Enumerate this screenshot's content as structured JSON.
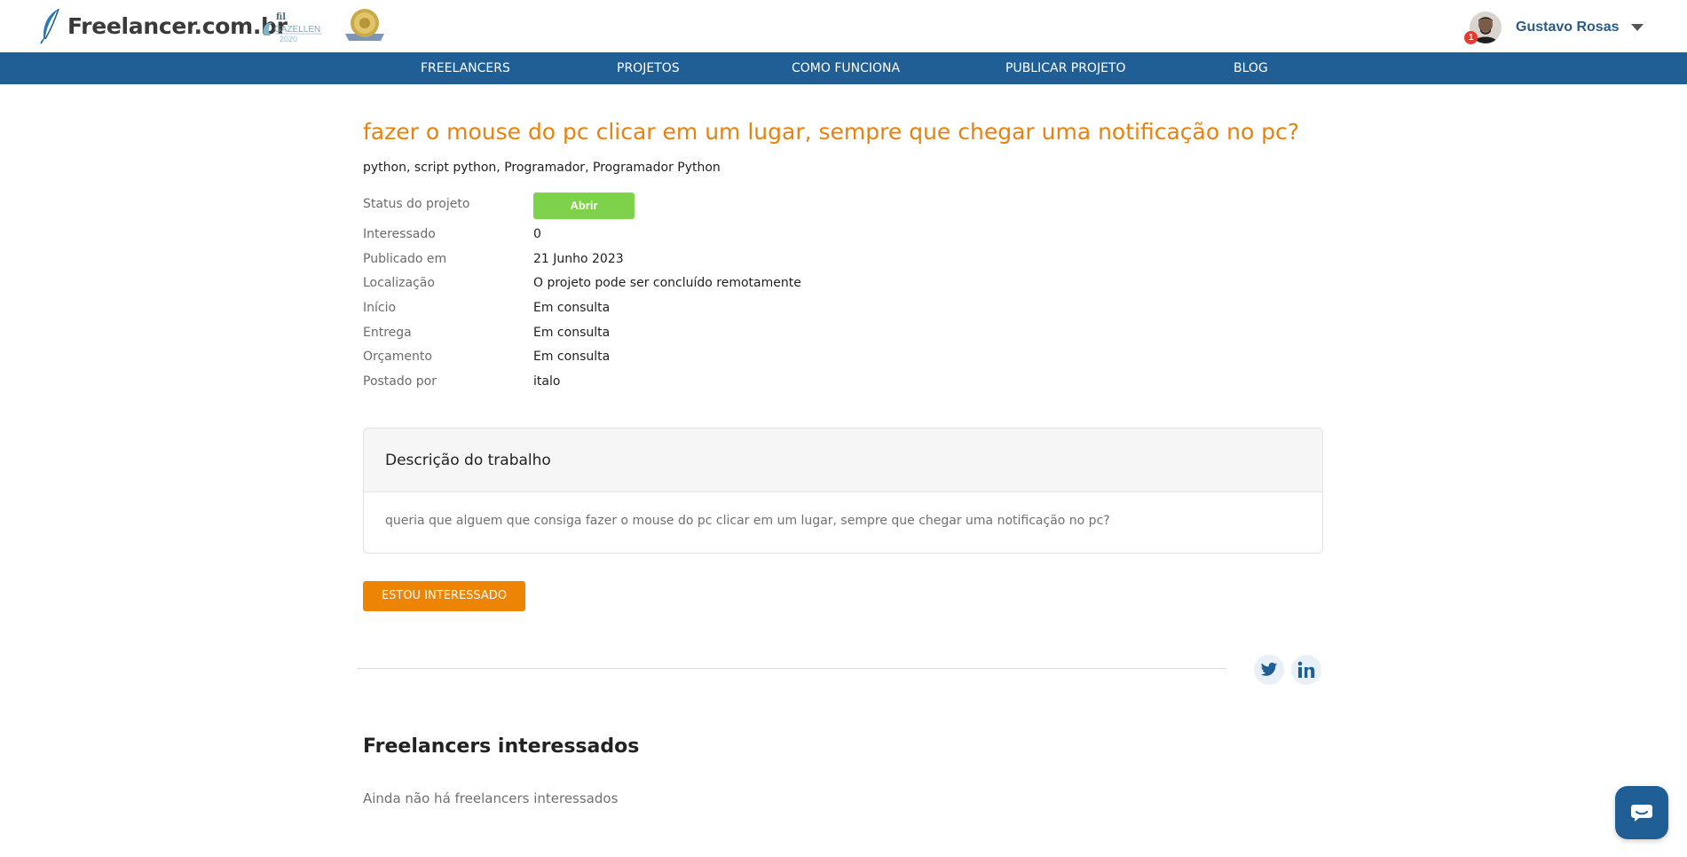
{
  "header": {
    "logo_text": "Freelancer.com.br",
    "award1_text": "GAZELLEN 2020",
    "user_name": "Gustavo Rosas",
    "notification_count": "1"
  },
  "nav": {
    "items": [
      "FREELANCERS",
      "PROJETOS",
      "COMO FUNCIONA",
      "PUBLICAR PROJETO",
      "BLOG"
    ]
  },
  "project": {
    "title": "fazer o mouse do pc clicar em um lugar, sempre que chegar uma notificação no pc?",
    "tags": "python, script python, Programador, Programador Python",
    "status_label": "Status do projeto",
    "status_value": "Abrir",
    "details": [
      {
        "label": "Interessado",
        "value": "0"
      },
      {
        "label": "Publicado em",
        "value": "21 Junho 2023"
      },
      {
        "label": "Localização",
        "value": "O projeto pode ser concluído remotamente"
      },
      {
        "label": "Início",
        "value": "Em consulta"
      },
      {
        "label": "Entrega",
        "value": "Em consulta"
      },
      {
        "label": "Orçamento",
        "value": "Em consulta"
      },
      {
        "label": "Postado por",
        "value": "italo"
      }
    ]
  },
  "description": {
    "heading": "Descrição do trabalho",
    "text": "queria que alguem que consiga fazer o mouse do pc clicar em um lugar, sempre que chegar uma notificação no pc?"
  },
  "actions": {
    "interest_button": "ESTOU INTERESSADO"
  },
  "share": {
    "icons": [
      "twitter-icon",
      "linkedin-icon"
    ]
  },
  "interested": {
    "heading": "Freelancers interessados",
    "empty_text": "Ainda não há freelancers interessados"
  },
  "colors": {
    "brand_blue": "#1f5f96",
    "title_orange": "#e8820e",
    "button_orange": "#ee8404",
    "status_green": "#7ed14a"
  }
}
